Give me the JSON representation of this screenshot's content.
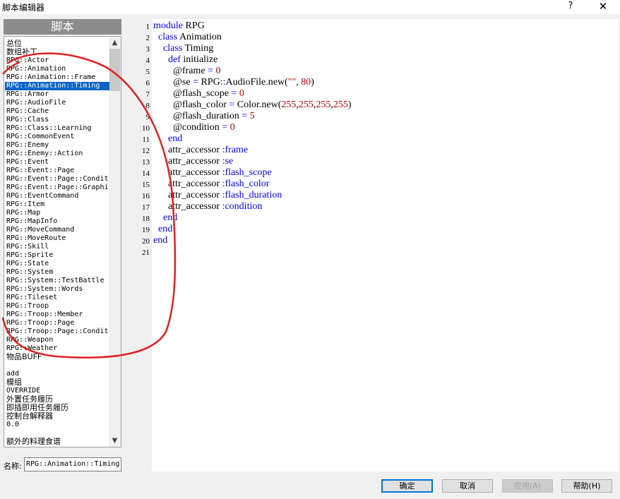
{
  "window": {
    "title": "脚本编辑器",
    "help_label": "?",
    "close_label": "✕"
  },
  "script_list": {
    "header": "脚本",
    "items": [
      "总位",
      "数组补丁",
      "RPG::Actor",
      "RPG::Animation",
      "RPG::Animation::Frame",
      "RPG::Animation::Timing",
      "RPG::Armor",
      "RPG::AudioFile",
      "RPG::Cache",
      "RPG::Class",
      "RPG::Class::Learning",
      "RPG::CommonEvent",
      "RPG::Enemy",
      "RPG::Enemy::Action",
      "RPG::Event",
      "RPG::Event::Page",
      "RPG::Event::Page::Condit",
      "RPG::Event::Page::Graphi",
      "RPG::EventCommand",
      "RPG::Item",
      "RPG::Map",
      "RPG::MapInfo",
      "RPG::MoveCommand",
      "RPG::MoveRoute",
      "RPG::Skill",
      "RPG::Sprite",
      "RPG::State",
      "RPG::System",
      "RPG::System::TestBattle",
      "RPG::System::Words",
      "RPG::Tileset",
      "RPG::Troop",
      "RPG::Troop::Member",
      "RPG::Troop::Page",
      "RPG::Troop::Page::Condit",
      "RPG::Weapon",
      "RPG::Weather",
      "物品BUFF",
      "",
      "add",
      "模组",
      "OVERRIDE",
      "外置任务履历",
      "即插即用任务履历",
      "控制台解释器",
      "0.0",
      "",
      "额外的料理食谱"
    ],
    "selected_index": 5,
    "scroll_up": "▲",
    "scroll_down": "▼"
  },
  "name_field": {
    "label": "名称:",
    "value": "RPG::Animation::Timing"
  },
  "editor": {
    "line_numbers": [
      "1",
      "2",
      "3",
      "4",
      "5",
      "6",
      "7",
      "8",
      "9",
      "10",
      "11",
      "12",
      "13",
      "14",
      "15",
      "16",
      "17",
      "18",
      "19",
      "20",
      "21"
    ],
    "lines": [
      [
        {
          "t": "module",
          "c": "kw"
        },
        {
          "t": " RPG",
          "c": ""
        }
      ],
      [
        {
          "t": "  class",
          "c": "kw"
        },
        {
          "t": " Animation",
          "c": ""
        }
      ],
      [
        {
          "t": "    class",
          "c": "kw"
        },
        {
          "t": " Timing",
          "c": ""
        }
      ],
      [
        {
          "t": "      def",
          "c": "kw"
        },
        {
          "t": " initialize",
          "c": ""
        }
      ],
      [
        {
          "t": "        @frame ",
          "c": ""
        },
        {
          "t": "=",
          "c": "op"
        },
        {
          "t": " ",
          "c": ""
        },
        {
          "t": "0",
          "c": "num"
        }
      ],
      [
        {
          "t": "        @se ",
          "c": ""
        },
        {
          "t": "=",
          "c": "op"
        },
        {
          "t": " RPG",
          "c": ""
        },
        {
          "t": "::",
          "c": "op"
        },
        {
          "t": "AudioFile.new(",
          "c": ""
        },
        {
          "t": "\"\"",
          "c": "str"
        },
        {
          "t": ", ",
          "c": ""
        },
        {
          "t": "80",
          "c": "num"
        },
        {
          "t": ")",
          "c": ""
        }
      ],
      [
        {
          "t": "        @flash_scope ",
          "c": ""
        },
        {
          "t": "=",
          "c": "op"
        },
        {
          "t": " ",
          "c": ""
        },
        {
          "t": "0",
          "c": "num"
        }
      ],
      [
        {
          "t": "        @flash_color ",
          "c": ""
        },
        {
          "t": "=",
          "c": "op"
        },
        {
          "t": " Color.new(",
          "c": ""
        },
        {
          "t": "255",
          "c": "num"
        },
        {
          "t": ",",
          "c": ""
        },
        {
          "t": "255",
          "c": "num"
        },
        {
          "t": ",",
          "c": ""
        },
        {
          "t": "255",
          "c": "num"
        },
        {
          "t": ",",
          "c": ""
        },
        {
          "t": "255",
          "c": "num"
        },
        {
          "t": ")",
          "c": ""
        }
      ],
      [
        {
          "t": "        @flash_duration ",
          "c": ""
        },
        {
          "t": "=",
          "c": "op"
        },
        {
          "t": " ",
          "c": ""
        },
        {
          "t": "5",
          "c": "num"
        }
      ],
      [
        {
          "t": "        @condition ",
          "c": ""
        },
        {
          "t": "=",
          "c": "op"
        },
        {
          "t": " ",
          "c": ""
        },
        {
          "t": "0",
          "c": "num"
        }
      ],
      [
        {
          "t": "      end",
          "c": "kw"
        }
      ],
      [
        {
          "t": "      attr_accessor ",
          "c": ""
        },
        {
          "t": ":frame",
          "c": "sym"
        }
      ],
      [
        {
          "t": "      attr_accessor ",
          "c": ""
        },
        {
          "t": ":se",
          "c": "sym"
        }
      ],
      [
        {
          "t": "      attr_accessor ",
          "c": ""
        },
        {
          "t": ":flash_scope",
          "c": "sym"
        }
      ],
      [
        {
          "t": "      attr_accessor ",
          "c": ""
        },
        {
          "t": ":flash_color",
          "c": "sym"
        }
      ],
      [
        {
          "t": "      attr_accessor ",
          "c": ""
        },
        {
          "t": ":flash_duration",
          "c": "sym"
        }
      ],
      [
        {
          "t": "      attr_accessor ",
          "c": ""
        },
        {
          "t": ":condition",
          "c": "sym"
        }
      ],
      [
        {
          "t": "    end",
          "c": "kw"
        }
      ],
      [
        {
          "t": "  end",
          "c": "kw"
        }
      ],
      [
        {
          "t": "end",
          "c": "kw"
        }
      ],
      []
    ]
  },
  "buttons": {
    "ok": "确定",
    "cancel": "取消",
    "apply": "应用(A)",
    "help": "帮助(H)"
  },
  "colors": {
    "keyword": "#0000ff",
    "number": "#b10000",
    "selection": "#0a64c8",
    "annotation": "#e02020"
  }
}
